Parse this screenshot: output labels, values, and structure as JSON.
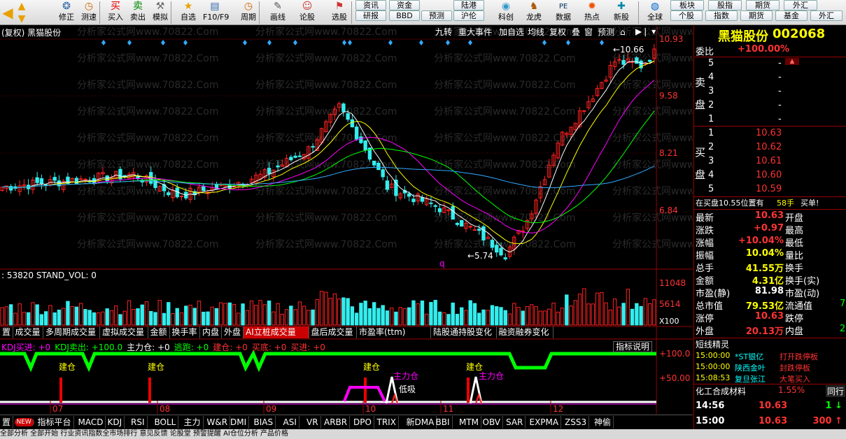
{
  "toolbar": {
    "left": [
      {
        "label": "修正",
        "icon": "refresh-icon"
      },
      {
        "label": "测速",
        "icon": "clock-icon"
      },
      {
        "label": "买入",
        "icon": "buy-icon"
      },
      {
        "label": "卖出",
        "icon": "sell-icon"
      },
      {
        "label": "模拟",
        "icon": "simulate-icon"
      },
      {
        "label": "自选",
        "icon": "star-icon"
      },
      {
        "label": "F10/F9",
        "icon": "f10-icon"
      },
      {
        "label": "周期",
        "icon": "clock-icon"
      },
      {
        "label": "画线",
        "icon": "draw-icon"
      },
      {
        "label": "论股",
        "icon": "chat-icon"
      },
      {
        "label": "选股",
        "icon": "select-icon"
      }
    ],
    "grid_top": [
      "资讯",
      "资金",
      "陆港",
      "板块",
      "股指",
      "期货",
      "外汇"
    ],
    "grid_bottom": [
      "研报",
      "BBD",
      "预测",
      "沪伦",
      "个股",
      "指数",
      "期货",
      "基金",
      "外汇"
    ],
    "right": [
      {
        "label": "科创",
        "icon": "kechuang-icon"
      },
      {
        "label": "龙虎",
        "icon": "tiger-icon"
      },
      {
        "label": "数据",
        "icon": "pe-icon"
      },
      {
        "label": "热点",
        "icon": "hot-icon"
      },
      {
        "label": "新股",
        "icon": "new-icon"
      },
      {
        "label": "全球",
        "icon": "globe-icon"
      }
    ],
    "pe_text": "PE"
  },
  "chart_header": {
    "title": "(复权) 黑猫股份",
    "watermark": "分析家公式网www.70822.Com"
  },
  "chart_buttons": [
    "九转",
    "重大事件",
    "加自选",
    "均线",
    "复权",
    "叠",
    "窗",
    "预测"
  ],
  "price_axis": [
    "10.93",
    "9.58",
    "8.21",
    "6.84"
  ],
  "high_label": "10.66",
  "low_label": "5.74",
  "marker_q": "q",
  "volume": {
    "header": ": 53820 STAND_VOL: 0",
    "axis": [
      "11048",
      "5614"
    ],
    "unit": "X100"
  },
  "tabs": [
    "置",
    "成交量",
    "多周期成交量",
    "虚拟成交量",
    "金额",
    "换手率",
    "内盘",
    "外盘",
    "AI立桩成交量",
    "盘后成交量",
    "市盈率(ttm)",
    "陆股通持股变化",
    "融资融券变化"
  ],
  "active_tab": "AI立桩成交量",
  "indicator": {
    "header": [
      {
        "t": "KDJ买进: +0",
        "c": "#f0f"
      },
      {
        "t": "KDJ卖出: +100.0",
        "c": "#0f0"
      },
      {
        "t": "主力仓: +0",
        "c": "#fff"
      },
      {
        "t": "逃跑: +0",
        "c": "#0f0"
      },
      {
        "t": "建仓: +0",
        "c": "#f33"
      },
      {
        "t": "买底: +0",
        "c": "#f33"
      },
      {
        "t": "买进: +0",
        "c": "#f33"
      }
    ],
    "explain_btn": "指标说明",
    "axis": [
      "+100.0",
      "+50.00"
    ],
    "labels": {
      "jc": "建仓",
      "zlc": "主力仓",
      "dx": "低吸"
    }
  },
  "months": [
    "07",
    "08",
    "09",
    "10",
    "11",
    "12"
  ],
  "stock": {
    "name": "黑猫股份",
    "code": "002068"
  },
  "weibi": {
    "label": "委比",
    "value": "+100.00%"
  },
  "sell_label": [
    "卖",
    "盘"
  ],
  "buy_label": [
    "买",
    "盘"
  ],
  "sell_levels": [
    "5",
    "4",
    "3",
    "2",
    "1"
  ],
  "buy_levels": [
    {
      "n": "1",
      "p": "10.63"
    },
    {
      "n": "2",
      "p": "10.62"
    },
    {
      "n": "3",
      "p": "10.61"
    },
    {
      "n": "4",
      "p": "10.60"
    },
    {
      "n": "5",
      "p": "10.59"
    }
  ],
  "buy_note": {
    "text": "在买盘10.55位置有",
    "vol": "58手",
    "act": "买单!"
  },
  "quote": [
    {
      "l": "最新",
      "v": "10.63",
      "r": "开盘",
      "rv": ""
    },
    {
      "l": "涨跌",
      "v": "+0.97",
      "r": "最高",
      "rv": ""
    },
    {
      "l": "涨幅",
      "v": "+10.04%",
      "r": "最低",
      "rv": ""
    },
    {
      "l": "振幅",
      "v": "10.04%",
      "r": "量比",
      "rv": ""
    },
    {
      "l": "总手",
      "v": "41.55万",
      "r": "换手",
      "rv": ""
    },
    {
      "l": "金额",
      "v": "4.31亿",
      "r": "换手(实)",
      "rv": ""
    },
    {
      "l": "市盈(静)",
      "v": "81.98",
      "r": "市盈(动)",
      "rv": ""
    },
    {
      "l": "总市值",
      "v": "79.53亿",
      "r": "流通值",
      "rv": "7"
    },
    {
      "l": "涨停",
      "v": "10.63",
      "r": "跌停",
      "rv": ""
    },
    {
      "l": "外盘",
      "v": "20.13万",
      "r": "内盘",
      "rv": "2"
    }
  ],
  "short_title": "短线精灵",
  "short_items": [
    {
      "t": "15:00:00",
      "n": "*ST银亿",
      "a": "打开跌停板"
    },
    {
      "t": "15:00:00",
      "n": "陕西金叶",
      "a": "封跌停板"
    },
    {
      "t": "15:08:53",
      "n": "复旦张江",
      "a": "大笔买入"
    }
  ],
  "sector": {
    "name": "化工合成材料",
    "pct": "1.55%",
    "btn": "同行"
  },
  "ticks": [
    {
      "t": "14:56",
      "p": "10.63",
      "v": "1"
    },
    {
      "t": "15:00",
      "p": "10.63",
      "v": "300"
    }
  ],
  "bottom_tabs": [
    "置",
    "NEW",
    "指标平台",
    "MACD",
    "KDJ",
    "RSI",
    "BOLL",
    "主力",
    "W&R",
    "DMI",
    "BIAS",
    "ASI",
    "VR",
    "ARBR",
    "DPO",
    "TRIX",
    "新DMA",
    "BBI",
    "MTM",
    "OBV",
    "SAR",
    "EXPMA",
    "ZSS3",
    "神偷"
  ],
  "status_text": "全部分析   全部开始   行业资讯指数全市场排行   意见反馈   论股堂   预警提醒   AI仓位分析   产品价格"
}
